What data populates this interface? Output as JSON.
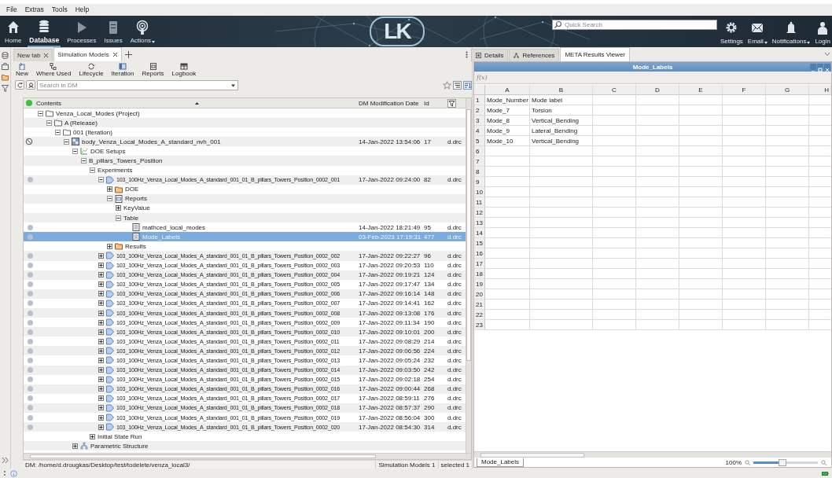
{
  "menu": [
    "File",
    "Extras",
    "Tools",
    "Help"
  ],
  "nav": [
    {
      "label": "Home",
      "kind": "home",
      "selected": false
    },
    {
      "label": "Database",
      "kind": "database",
      "selected": true
    },
    {
      "label": "Processes",
      "kind": "processes",
      "selected": false
    },
    {
      "label": "Issues",
      "kind": "issues",
      "selected": false
    },
    {
      "label": "Actions",
      "kind": "actions",
      "selected": false,
      "menu": true
    }
  ],
  "logo": {
    "text": "LK"
  },
  "quick_search": {
    "placeholder": "Quick Search"
  },
  "user_actions": [
    {
      "label": "Settings",
      "kind": "settings"
    },
    {
      "label": "Email",
      "kind": "email",
      "menu": true
    },
    {
      "label": "Notifications",
      "kind": "notifications",
      "menu": true
    },
    {
      "label": "Login",
      "kind": "login"
    }
  ],
  "left_panel": {
    "tabs": [
      {
        "label": "New tab",
        "selected": false
      },
      {
        "label": "Simulation Models",
        "selected": true
      }
    ],
    "toolbar": [
      {
        "label": "New",
        "kind": "new"
      },
      {
        "label": "Where Used",
        "kind": "where-used"
      },
      {
        "label": "Lifecycle",
        "kind": "lifecycle"
      },
      {
        "label": "Iteration",
        "kind": "iteration"
      },
      {
        "label": "Reports",
        "kind": "reports"
      },
      {
        "label": "Logbook",
        "kind": "logbook"
      }
    ],
    "search": {
      "placeholder": "Search in DM"
    },
    "tree": {
      "columns": [
        "Contents",
        "DM Modification Date",
        "Id"
      ],
      "rows": [
        {
          "label": "Venza_Local_Modes (Project)",
          "kind": "folder",
          "expanded": true,
          "selected": false,
          "children": [
            {
              "label": "A (Release)",
              "kind": "folder",
              "expanded": true,
              "selected": false,
              "children": [
                {
                  "label": "001 (Iteration)",
                  "kind": "folder",
                  "expanded": true,
                  "selected": false,
                  "children": [
                    {
                      "label": "body_Venza_Local_Modes_A_standard_nvh_001",
                      "kind": "model",
                      "blocked": true,
                      "expanded": true,
                      "selected": false,
                      "date": "14-Jan-2022 13:54:06",
                      "id": "17",
                      "owner": "d.drc",
                      "children": [
                        {
                          "label": "DOE Setups",
                          "kind": "doe",
                          "expanded": true,
                          "selected": false,
                          "children": [
                            {
                              "label": "B_pillars_Towers_Position",
                              "expanded": true,
                              "selected": false,
                              "children": [
                                {
                                  "label": "Experiments",
                                  "expanded": true,
                                  "selected": false,
                                  "children": [
                                    {
                                      "label": "103_100Hz_Venza_Local_Modes_A_standard_001_01_B_pillars_Towers_Position_0002_001",
                                      "kind": "experiment",
                                      "dot": true,
                                      "expanded": true,
                                      "selected": false,
                                      "date": "17-Jan-2022 09:24:00",
                                      "id": "82",
                                      "owner": "d.drc",
                                      "children": [
                                        {
                                          "label": "DOE",
                                          "kind": "folder-filled",
                                          "expanded": false,
                                          "selected": false
                                        },
                                        {
                                          "label": "Reports",
                                          "kind": "report",
                                          "expanded": true,
                                          "selected": false,
                                          "children": [
                                            {
                                              "label": "KeyValue",
                                              "expanded": false,
                                              "selected": false
                                            },
                                            {
                                              "label": "Table",
                                              "expanded": true,
                                              "selected": false,
                                              "children": [
                                                {
                                                  "label": "mathced_local_modes",
                                                  "kind": "table-doc",
                                                  "dot": true,
                                                  "selected": false,
                                                  "date": "14-Jan-2022 18:21:49",
                                                  "id": "95",
                                                  "owner": "d.drc"
                                                },
                                                {
                                                  "label": "Mode_Labels",
                                                  "kind": "table-doc",
                                                  "dot": true,
                                                  "selected": true,
                                                  "date": "03-Feb-2023 17:19:31",
                                                  "id": "477",
                                                  "owner": "d.drc"
                                                }
                                              ]
                                            }
                                          ]
                                        },
                                        {
                                          "label": "Results",
                                          "kind": "folder-filled",
                                          "expanded": false,
                                          "selected": false
                                        }
                                      ]
                                    },
                                    {
                                      "label": "103_100Hz_Venza_Local_Modes_A_standard_001_01_B_pillars_Towers_Position_0002_002",
                                      "kind": "experiment",
                                      "dot": true,
                                      "expanded": false,
                                      "selected": false,
                                      "date": "17-Jan-2022 09:22:27",
                                      "id": "96",
                                      "owner": "d.drc"
                                    },
                                    {
                                      "label": "103_100Hz_Venza_Local_Modes_A_standard_001_01_B_pillars_Towers_Position_0002_003",
                                      "kind": "experiment",
                                      "dot": true,
                                      "expanded": false,
                                      "selected": false,
                                      "date": "17-Jan-2022 09:20:53",
                                      "id": "110",
                                      "owner": "d.drc"
                                    },
                                    {
                                      "label": "103_100Hz_Venza_Local_Modes_A_standard_001_01_B_pillars_Towers_Position_0002_004",
                                      "kind": "experiment",
                                      "dot": true,
                                      "expanded": false,
                                      "selected": false,
                                      "date": "17-Jan-2022 09:19:21",
                                      "id": "124",
                                      "owner": "d.drc"
                                    },
                                    {
                                      "label": "103_100Hz_Venza_Local_Modes_A_standard_001_01_B_pillars_Towers_Position_0002_005",
                                      "kind": "experiment",
                                      "dot": true,
                                      "expanded": false,
                                      "selected": false,
                                      "date": "17-Jan-2022 09:17:47",
                                      "id": "134",
                                      "owner": "d.drc"
                                    },
                                    {
                                      "label": "103_100Hz_Venza_Local_Modes_A_standard_001_01_B_pillars_Towers_Position_0002_006",
                                      "kind": "experiment",
                                      "dot": true,
                                      "expanded": false,
                                      "selected": false,
                                      "date": "17-Jan-2022 09:16:14",
                                      "id": "148",
                                      "owner": "d.drc"
                                    },
                                    {
                                      "label": "103_100Hz_Venza_Local_Modes_A_standard_001_01_B_pillars_Towers_Position_0002_007",
                                      "kind": "experiment",
                                      "dot": true,
                                      "expanded": false,
                                      "selected": false,
                                      "date": "17-Jan-2022 09:14:41",
                                      "id": "162",
                                      "owner": "d.drc"
                                    },
                                    {
                                      "label": "103_100Hz_Venza_Local_Modes_A_standard_001_01_B_pillars_Towers_Position_0002_008",
                                      "kind": "experiment",
                                      "dot": true,
                                      "expanded": false,
                                      "selected": false,
                                      "date": "17-Jan-2022 09:13:08",
                                      "id": "176",
                                      "owner": "d.drc"
                                    },
                                    {
                                      "label": "103_100Hz_Venza_Local_Modes_A_standard_001_01_B_pillars_Towers_Position_0002_009",
                                      "kind": "experiment",
                                      "dot": true,
                                      "expanded": false,
                                      "selected": false,
                                      "date": "17-Jan-2022 09:11:34",
                                      "id": "190",
                                      "owner": "d.drc"
                                    },
                                    {
                                      "label": "103_100Hz_Venza_Local_Modes_A_standard_001_01_B_pillars_Towers_Position_0002_010",
                                      "kind": "experiment",
                                      "dot": true,
                                      "expanded": false,
                                      "selected": false,
                                      "date": "17-Jan-2022 09:10:01",
                                      "id": "200",
                                      "owner": "d.drc"
                                    },
                                    {
                                      "label": "103_100Hz_Venza_Local_Modes_A_standard_001_01_B_pillars_Towers_Position_0002_011",
                                      "kind": "experiment",
                                      "dot": true,
                                      "expanded": false,
                                      "selected": false,
                                      "date": "17-Jan-2022 09:08:29",
                                      "id": "214",
                                      "owner": "d.drc"
                                    },
                                    {
                                      "label": "103_100Hz_Venza_Local_Modes_A_standard_001_01_B_pillars_Towers_Position_0002_012",
                                      "kind": "experiment",
                                      "dot": true,
                                      "expanded": false,
                                      "selected": false,
                                      "date": "17-Jan-2022 09:06:56",
                                      "id": "224",
                                      "owner": "d.drc"
                                    },
                                    {
                                      "label": "103_100Hz_Venza_Local_Modes_A_standard_001_01_B_pillars_Towers_Position_0002_013",
                                      "kind": "experiment",
                                      "dot": true,
                                      "expanded": false,
                                      "selected": false,
                                      "date": "17-Jan-2022 09:05:24",
                                      "id": "232",
                                      "owner": "d.drc"
                                    },
                                    {
                                      "label": "103_100Hz_Venza_Local_Modes_A_standard_001_01_B_pillars_Towers_Position_0002_014",
                                      "kind": "experiment",
                                      "dot": true,
                                      "expanded": false,
                                      "selected": false,
                                      "date": "17-Jan-2022 09:03:50",
                                      "id": "242",
                                      "owner": "d.drc"
                                    },
                                    {
                                      "label": "103_100Hz_Venza_Local_Modes_A_standard_001_01_B_pillars_Towers_Position_0002_015",
                                      "kind": "experiment",
                                      "dot": true,
                                      "expanded": false,
                                      "selected": false,
                                      "date": "17-Jan-2022 09:02:18",
                                      "id": "254",
                                      "owner": "d.drc"
                                    },
                                    {
                                      "label": "103_100Hz_Venza_Local_Modes_A_standard_001_01_B_pillars_Towers_Position_0002_016",
                                      "kind": "experiment",
                                      "dot": true,
                                      "expanded": false,
                                      "selected": false,
                                      "date": "17-Jan-2022 09:00:44",
                                      "id": "268",
                                      "owner": "d.drc"
                                    },
                                    {
                                      "label": "103_100Hz_Venza_Local_Modes_A_standard_001_01_B_pillars_Towers_Position_0002_017",
                                      "kind": "experiment",
                                      "dot": true,
                                      "expanded": false,
                                      "selected": false,
                                      "date": "17-Jan-2022 08:59:11",
                                      "id": "276",
                                      "owner": "d.drc"
                                    },
                                    {
                                      "label": "103_100Hz_Venza_Local_Modes_A_standard_001_01_B_pillars_Towers_Position_0002_018",
                                      "kind": "experiment",
                                      "dot": true,
                                      "expanded": false,
                                      "selected": false,
                                      "date": "17-Jan-2022 08:57:37",
                                      "id": "290",
                                      "owner": "d.drc"
                                    },
                                    {
                                      "label": "103_100Hz_Venza_Local_Modes_A_standard_001_01_B_pillars_Towers_Position_0002_019",
                                      "kind": "experiment",
                                      "dot": true,
                                      "expanded": false,
                                      "selected": false,
                                      "date": "17-Jan-2022 08:56:04",
                                      "id": "300",
                                      "owner": "d.drc"
                                    },
                                    {
                                      "label": "103_100Hz_Venza_Local_Modes_A_standard_001_01_B_pillars_Towers_Position_0002_020",
                                      "kind": "experiment",
                                      "dot": true,
                                      "expanded": false,
                                      "selected": false,
                                      "date": "17-Jan-2022 08:54:30",
                                      "id": "314",
                                      "owner": "d.drc"
                                    }
                                  ]
                                },
                                {
                                  "label": "Initial State Run",
                                  "expanded": false,
                                  "selected": false
                                }
                              ]
                            }
                          ]
                        },
                        {
                          "label": "Parametric Structure",
                          "kind": "parametric",
                          "expanded": false,
                          "selected": false
                        }
                      ]
                    }
                  ]
                }
              ]
            }
          ]
        }
      ]
    },
    "status_bar": {
      "path": "DM: /home/d.drougkas/Desktop/test/todelete/venza_local3/",
      "count": "Simulation Models 1",
      "selection": "selected 1"
    }
  },
  "right_panel": {
    "tabs": [
      {
        "label": "Details",
        "kind": "details",
        "selected": false
      },
      {
        "label": "References",
        "kind": "references",
        "selected": false
      },
      {
        "label": "META Results Viewer",
        "selected": true
      }
    ],
    "viewer": {
      "title": "Mode_Labels",
      "formula_label": "f(x)",
      "columns": [
        "A",
        "B",
        "C",
        "D",
        "E",
        "F",
        "G",
        "H"
      ],
      "rows": [
        {
          "number": "1",
          "cells": [
            "Mode_Number",
            "Mode label"
          ]
        },
        {
          "number": "2",
          "cells": [
            "Mode_7",
            "Torsion"
          ]
        },
        {
          "number": "3",
          "cells": [
            "Mode_8",
            "Vertical_Bending"
          ]
        },
        {
          "number": "4",
          "cells": [
            "Mode_9",
            "Lateral_Bending"
          ]
        },
        {
          "number": "5",
          "cells": [
            "Mode_10",
            "Vertical_Bending"
          ]
        },
        {
          "number": "6"
        },
        {
          "number": "7"
        },
        {
          "number": "8"
        },
        {
          "number": "9"
        },
        {
          "number": "10"
        },
        {
          "number": "11"
        },
        {
          "number": "12"
        },
        {
          "number": "13"
        },
        {
          "number": "14"
        },
        {
          "number": "15"
        },
        {
          "number": "16"
        },
        {
          "number": "17"
        },
        {
          "number": "18"
        },
        {
          "number": "19"
        },
        {
          "number": "20"
        },
        {
          "number": "21"
        },
        {
          "number": "22"
        },
        {
          "number": "23"
        }
      ],
      "sheet_tabs": [
        {
          "label": "Mode_Labels",
          "selected": true
        }
      ],
      "zoom": {
        "reading": "100%",
        "level": 0.45
      }
    }
  }
}
